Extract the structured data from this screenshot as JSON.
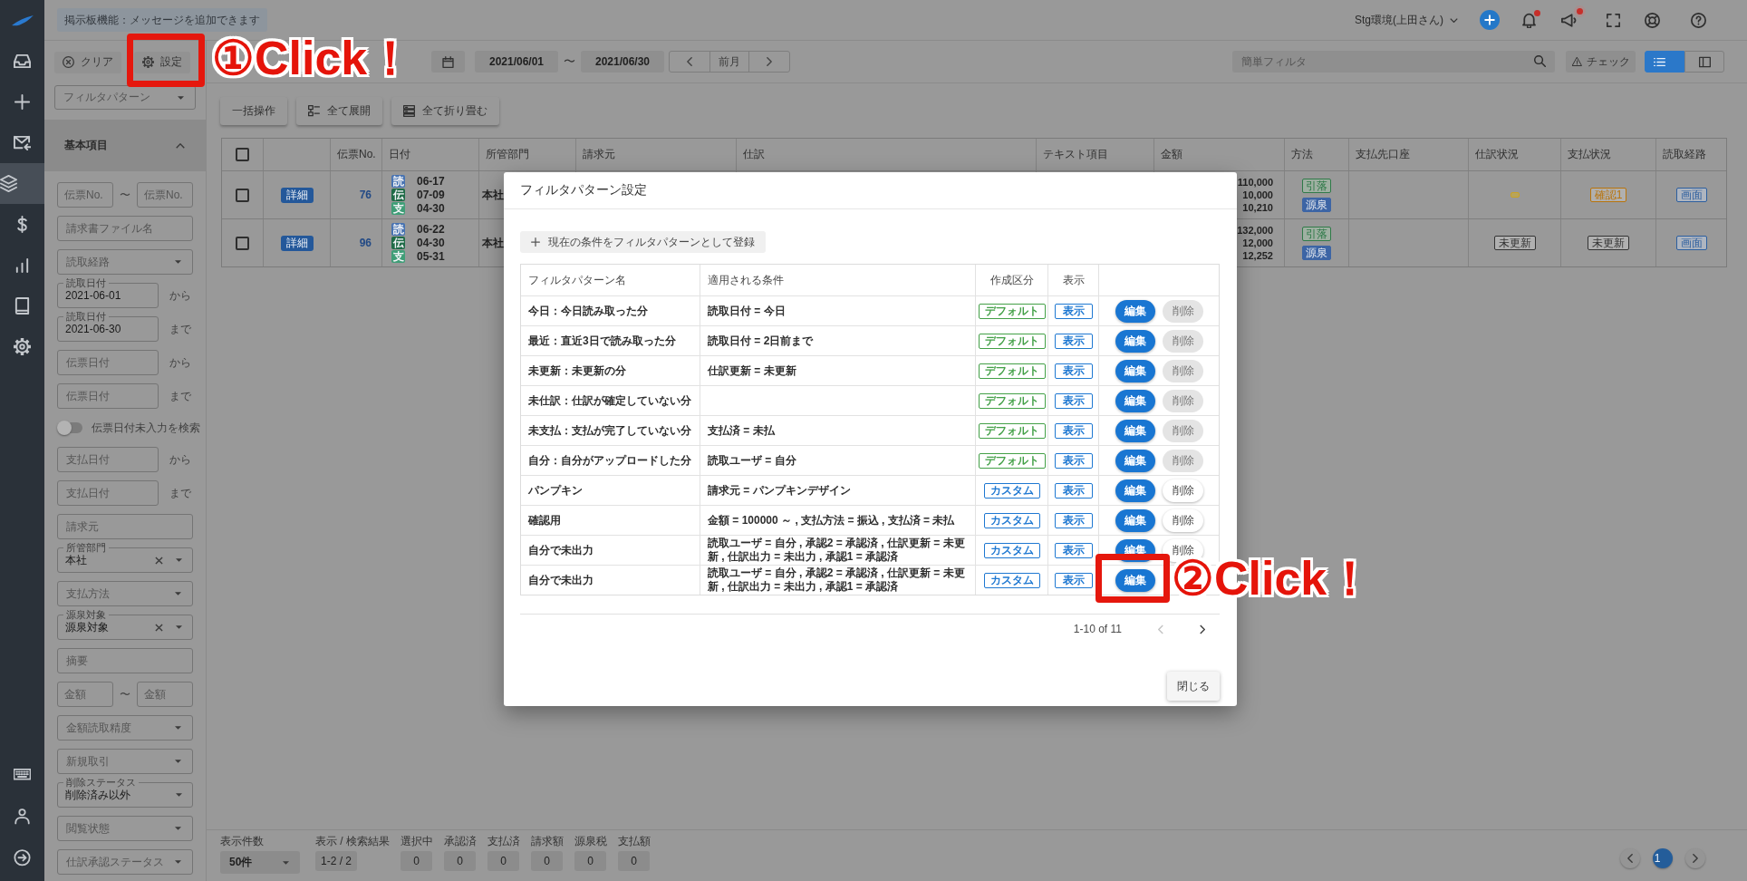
{
  "nav": {
    "items": [
      {
        "selected": false
      },
      {
        "selected": false
      },
      {
        "selected": false
      },
      {
        "selected": true
      },
      {
        "selected": false
      },
      {
        "selected": false
      },
      {
        "selected": false
      },
      {
        "selected": false
      }
    ]
  },
  "topbar": {
    "notice": "掲示板機能：メッセージを追加できます",
    "environment": "Stg環境(上田さん)",
    "bell_unread": true,
    "announcement_unread": true
  },
  "filter_panel": {
    "clear": "クリア",
    "settings": "設定",
    "pattern_placeholder": "フィルタパターン",
    "section": "基本項目",
    "expanded": true,
    "fields": [
      {
        "kind": "range",
        "placeholder": "伝票No.",
        "placeholder_to": "伝票No.",
        "separator": "〜"
      },
      {
        "kind": "text",
        "placeholder": "請求書ファイル名"
      },
      {
        "kind": "select",
        "placeholder": "読取経路"
      },
      {
        "kind": "date",
        "label": "読取日付",
        "value": "2021-06-01",
        "suffix": "から"
      },
      {
        "kind": "date",
        "label": "読取日付",
        "value": "2021-06-30",
        "suffix": "まで"
      },
      {
        "kind": "date",
        "placeholder": "伝票日付",
        "suffix": "から"
      },
      {
        "kind": "date",
        "placeholder": "伝票日付",
        "suffix": "まで"
      },
      {
        "kind": "toggle",
        "label": "伝票日付未入力を検索",
        "on": false
      },
      {
        "kind": "date",
        "placeholder": "支払日付",
        "suffix": "から"
      },
      {
        "kind": "date",
        "placeholder": "支払日付",
        "suffix": "まで"
      },
      {
        "kind": "text",
        "placeholder": "請求元"
      },
      {
        "kind": "select",
        "label": "所管部門",
        "value": "本社",
        "clearable": true
      },
      {
        "kind": "select",
        "placeholder": "支払方法"
      },
      {
        "kind": "select",
        "label": "源泉対象",
        "value": "源泉対象",
        "clearable": true
      },
      {
        "kind": "text",
        "placeholder": "摘要"
      },
      {
        "kind": "range",
        "placeholder": "金額",
        "placeholder_to": "金額",
        "separator": "〜"
      },
      {
        "kind": "select",
        "placeholder": "金額読取精度"
      },
      {
        "kind": "select",
        "placeholder": "新規取引"
      },
      {
        "kind": "select",
        "label": "削除ステータス",
        "value": "削除済み以外"
      },
      {
        "kind": "select",
        "placeholder": "閲覧状態"
      },
      {
        "kind": "select",
        "placeholder": "仕訳承認ステータス"
      }
    ]
  },
  "toolbar": {
    "date_from": "2021/06/01",
    "date_separator": "〜",
    "date_to": "2021/06/30",
    "previous_month": "前月",
    "search_placeholder": "簡単フィルタ",
    "check": "チェック",
    "views": [
      {
        "selected": true
      },
      {
        "selected": false
      }
    ]
  },
  "actions": [
    {
      "label": "一括操作",
      "kind": "plain"
    },
    {
      "label": "全て展開",
      "kind": "expand"
    },
    {
      "label": "全て折り畳む",
      "kind": "collapse"
    }
  ],
  "table": {
    "all_checked": false,
    "columns": [
      "伝票No.",
      "日付",
      "所管部門",
      "請求元",
      "仕訳",
      "テキスト項目",
      "金額",
      "方法",
      "支払先口座",
      "仕訳状況",
      "支払状況",
      "読取経路"
    ],
    "rows": [
      {
        "checked": false,
        "detail": "詳細",
        "number": "76",
        "dates": [
          {
            "tag": "読",
            "date": "06-17",
            "color": "#4873b2"
          },
          {
            "tag": "伝",
            "date": "07-09",
            "color": "#1f6b47"
          },
          {
            "tag": "支",
            "date": "04-30",
            "color": "#3f9e77"
          }
        ],
        "department": "本社",
        "amounts": [
          "110,000",
          "10,000",
          "10,210"
        ],
        "methods": [
          {
            "label": "引落",
            "kind": "outline",
            "color": "#2f7a48"
          },
          {
            "label": "源泉",
            "kind": "filled",
            "color": "#3d65a5"
          }
        ],
        "journal_status": {
          "color": "#c9a227"
        },
        "payment_status": {
          "label": "確認1",
          "color": "#b8730a"
        },
        "route": {
          "label": "画面",
          "color": "#2c5e9e"
        }
      },
      {
        "checked": false,
        "detail": "詳細",
        "number": "96",
        "dates": [
          {
            "tag": "読",
            "date": "06-22",
            "color": "#4873b2"
          },
          {
            "tag": "伝",
            "date": "04-30",
            "color": "#1f6b47"
          },
          {
            "tag": "支",
            "date": "05-31",
            "color": "#3f9e77"
          }
        ],
        "department": "本社",
        "amounts": [
          "132,000",
          "12,000",
          "12,252"
        ],
        "methods": [
          {
            "label": "引落",
            "kind": "outline",
            "color": "#2f7a48"
          },
          {
            "label": "源泉",
            "kind": "filled",
            "color": "#3d65a5"
          }
        ],
        "journal_status": {
          "label": "未更新",
          "color": "#333333"
        },
        "payment_status": {
          "label": "未更新",
          "color": "#333333"
        },
        "route": {
          "label": "画面",
          "color": "#2c5e9e"
        }
      }
    ]
  },
  "status_bar": {
    "per_page_label": "表示件数",
    "per_page": "50件",
    "counters": [
      {
        "label": "表示 / 検索結果",
        "value": "1-2 / 2"
      },
      {
        "label": "選択中",
        "value": "0"
      },
      {
        "label": "承認済",
        "value": "0"
      },
      {
        "label": "支払済",
        "value": "0"
      },
      {
        "label": "請求額",
        "value": "0"
      },
      {
        "label": "源泉税",
        "value": "0"
      },
      {
        "label": "支払額",
        "value": "0"
      }
    ],
    "pages": [
      {
        "label": "1",
        "selected": true
      }
    ]
  },
  "dialog": {
    "title": "フィルタパターン設定",
    "add": "現在の条件をフィルタパターンとして登録",
    "columns": [
      "フィルタパターン名",
      "適用される条件",
      "作成区分",
      "表示"
    ],
    "rows": [
      {
        "name": "今日：今日読み取った分",
        "condition": "読取日付 = 今日",
        "category": {
          "label": "デフォルト",
          "color": "#43a047"
        },
        "display": "表示",
        "edit": "編集",
        "delete": "削除",
        "delete_enabled": false
      },
      {
        "name": "最近：直近3日で読み取った分",
        "condition": "読取日付 = 2日前まで",
        "category": {
          "label": "デフォルト",
          "color": "#43a047"
        },
        "display": "表示",
        "edit": "編集",
        "delete": "削除",
        "delete_enabled": false
      },
      {
        "name": "未更新：未更新の分",
        "condition": "仕訳更新 = 未更新",
        "category": {
          "label": "デフォルト",
          "color": "#43a047"
        },
        "display": "表示",
        "edit": "編集",
        "delete": "削除",
        "delete_enabled": false
      },
      {
        "name": "未仕訳：仕訳が確定していない分",
        "category": {
          "label": "デフォルト",
          "color": "#43a047"
        },
        "display": "表示",
        "edit": "編集",
        "delete": "削除",
        "delete_enabled": false
      },
      {
        "name": "未支払：支払が完了していない分",
        "condition": "支払済 = 未払",
        "category": {
          "label": "デフォルト",
          "color": "#43a047"
        },
        "display": "表示",
        "edit": "編集",
        "delete": "削除",
        "delete_enabled": false
      },
      {
        "name": "自分：自分がアップロードした分",
        "condition": "読取ユーザ = 自分",
        "category": {
          "label": "デフォルト",
          "color": "#43a047"
        },
        "display": "表示",
        "edit": "編集",
        "delete": "削除",
        "delete_enabled": false
      },
      {
        "name": "パンプキン",
        "condition": "請求元 = パンプキンデザイン",
        "category": {
          "label": "カスタム",
          "color": "#1e78d2"
        },
        "display": "表示",
        "edit": "編集",
        "delete": "削除",
        "delete_enabled": true
      },
      {
        "name": "確認用",
        "condition": "金額 = 100000 ～ , 支払方法 = 振込 , 支払済 = 未払",
        "category": {
          "label": "カスタム",
          "color": "#1e78d2"
        },
        "display": "表示",
        "edit": "編集",
        "delete": "削除",
        "delete_enabled": true
      },
      {
        "name": "自分で未出力",
        "condition": "読取ユーザ = 自分 , 承認2 = 承認済 , 仕訳更新 = 未更新 , 仕訳出力 = 未出力 , 承認1 = 承認済",
        "category": {
          "label": "カスタム",
          "color": "#1e78d2"
        },
        "display": "表示",
        "edit": "編集",
        "delete": "削除",
        "delete_enabled": true
      },
      {
        "name": "自分で未出力",
        "condition": "読取ユーザ = 自分 , 承認2 = 承認済 , 仕訳更新 = 未更新 , 仕訳出力 = 未出力 , 承認1 = 承認済",
        "category": {
          "label": "カスタム",
          "color": "#1e78d2"
        },
        "display": "表示",
        "edit": "編集"
      }
    ],
    "range": "1-10 of 11",
    "previous_enabled": false,
    "next_enabled": true,
    "close": "閉じる"
  },
  "annotations": [
    {
      "label": "①Click！"
    },
    {
      "label": "②Click！"
    }
  ]
}
